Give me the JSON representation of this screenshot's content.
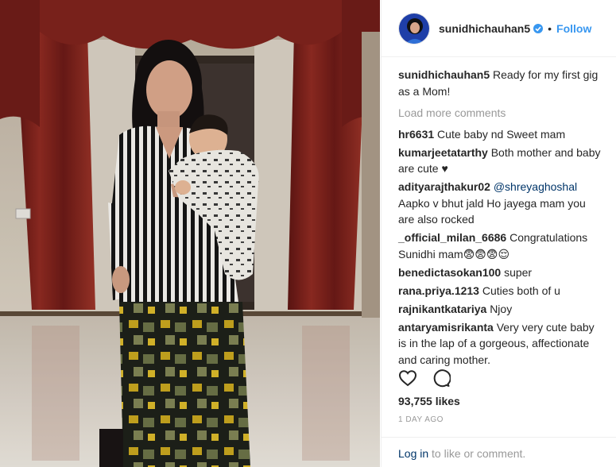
{
  "post": {
    "username": "sunidhichauhan5",
    "separator": "•",
    "follow_label": "Follow",
    "caption_user": "sunidhichauhan5",
    "caption_text": "Ready for my first gig as a Mom!",
    "load_more_label": "Load more comments",
    "comments": [
      {
        "user": "hr6631",
        "text": "Cute baby nd Sweet mam"
      },
      {
        "user": "kumarjeetatarthy",
        "text": "Both mother and baby are cute ♥"
      },
      {
        "user": "adityarajthakur02",
        "mention": "@shreyaghoshal",
        "text": "Aapko v bhut jald Ho jayega mam you are also rocked"
      },
      {
        "user": "_official_milan_6686",
        "text": "Congratulations Sunidhi mam😨😨😨😌"
      },
      {
        "user": "benedictasokan100",
        "text": "super"
      },
      {
        "user": "rana.priya.1213",
        "text": "Cuties both of u"
      },
      {
        "user": "rajnikantkatariya",
        "text": "Njoy"
      },
      {
        "user": "antaryamisrikanta",
        "text": "Very very cute baby is in the lap of a gorgeous, affectionate and caring mother."
      }
    ],
    "likes": "93,755 likes",
    "date": "1 DAY AGO",
    "footer_login": "Log in",
    "footer_text": " to like or comment."
  },
  "icons": {
    "like": "heart-icon",
    "comment": "comment-bubble-icon",
    "verified": "verified-badge-icon"
  },
  "colors": {
    "accent": "#3897f0",
    "link_dark": "#003569",
    "muted": "#999999",
    "text": "#262626"
  }
}
